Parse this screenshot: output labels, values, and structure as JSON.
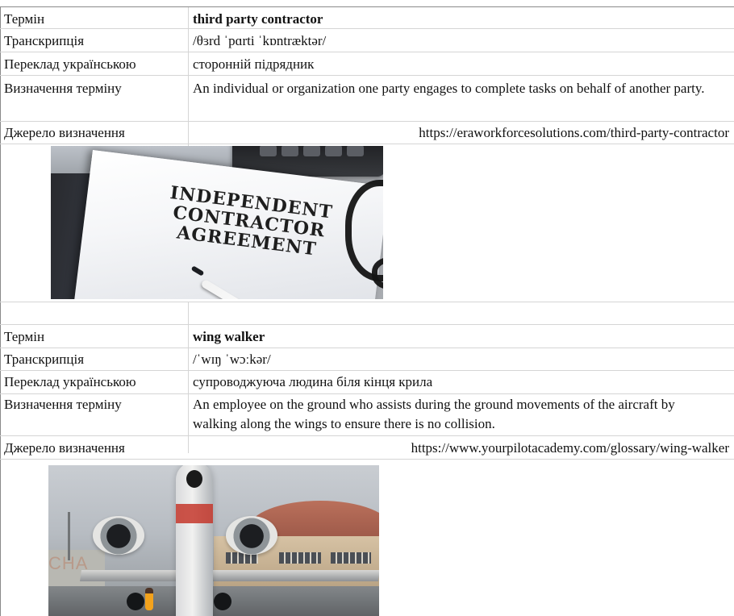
{
  "entries": [
    {
      "fields": {
        "term_label": "Термін",
        "term_value": "third party contractor",
        "transcription_label": "Транскрипція",
        "transcription_value": "/θɜrd ˈpɑrti ˈkɒntræktər/",
        "translation_label": "Переклад українською",
        "translation_value": "сторонній підрядник",
        "definition_label": "Визначення терміну",
        "definition_value": "An individual or organization one party engages to complete tasks on behalf of another party.",
        "source_label": "Джерело визначення",
        "source_value": "https://eraworkforcesolutions.com/third-party-contractor"
      },
      "image": {
        "text_lines": [
          "INDEPENDENT",
          "CONTRACTOR",
          "AGREEMENT"
        ]
      }
    },
    {
      "fields": {
        "term_label": "Термін",
        "term_value": "wing walker",
        "transcription_label": "Транскрипція",
        "transcription_value": "/ˈwɪŋ ˈwɔːkər/",
        "translation_label": "Переклад українською",
        "translation_value": "супроводжуюча людина біля кінця крила",
        "definition_label": "Визначення терміну",
        "definition_value": "An employee on the ground who assists during the ground movements of the aircraft by walking along the wings to ensure there is no collision.",
        "source_label": "Джерело визначення",
        "source_value": "https://www.yourpilotacademy.com/glossary/wing-walker"
      },
      "image": {
        "visible_sign_text": "CHA"
      }
    }
  ]
}
